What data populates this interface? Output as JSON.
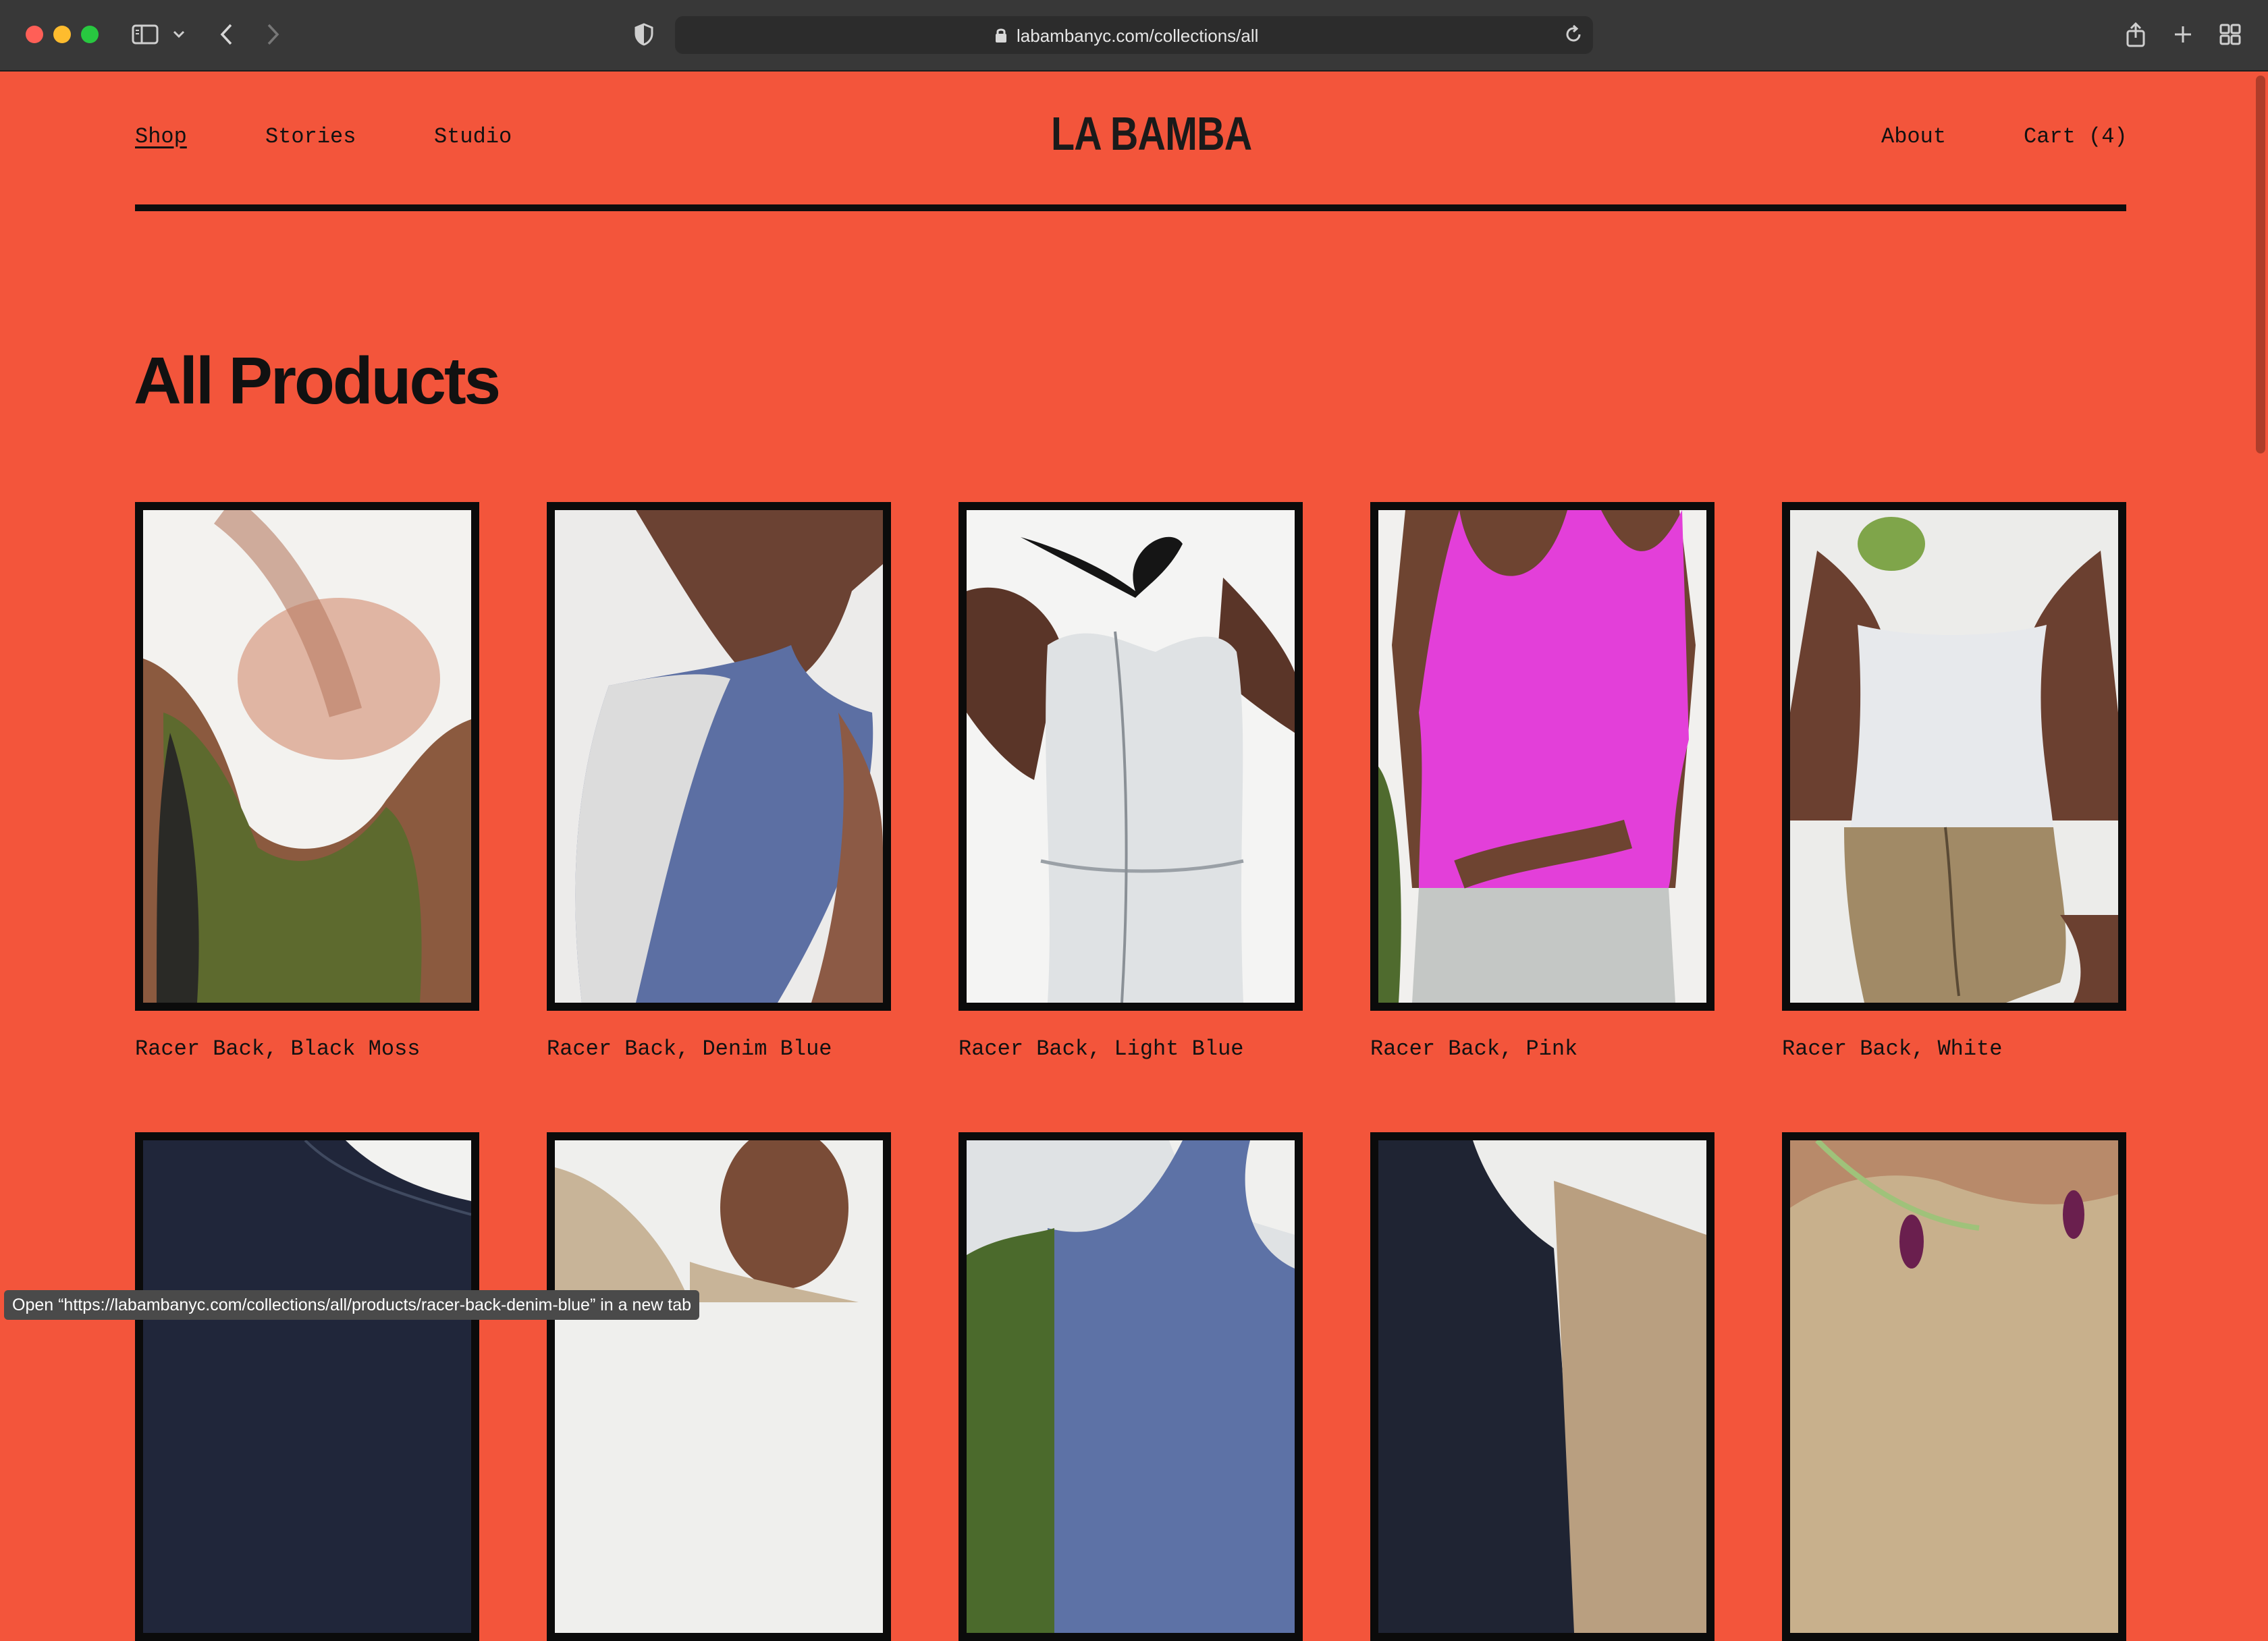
{
  "browser": {
    "url": "labambanyc.com/collections/all",
    "status_text": "Open “https://labambanyc.com/collections/all/products/racer-back-denim-blue” in a new tab",
    "colors": {
      "chrome": "#383838",
      "address_bar": "#2c2c2c"
    }
  },
  "nav": {
    "left": [
      "Shop",
      "Stories",
      "Studio"
    ],
    "logo": "LA BAMBA",
    "about": "About",
    "cart": "Cart (4)"
  },
  "page": {
    "title": "All Products",
    "background": "#f3553b"
  },
  "products": [
    {
      "name": "Racer Back, Black Moss",
      "color": "#5d6a2e"
    },
    {
      "name": "Racer Back, Denim Blue",
      "color": "#5c6fa3"
    },
    {
      "name": "Racer Back, Light Blue",
      "color": "#dfe2e4"
    },
    {
      "name": "Racer Back, Pink",
      "color": "#e33fd9"
    },
    {
      "name": "Racer Back, White",
      "color": "#e7e9ec"
    }
  ],
  "products_row2": [
    {
      "color": "#20263a"
    },
    {
      "color": "#c8b498"
    },
    {
      "color": "#5d72a6"
    },
    {
      "color": "#1f2433"
    },
    {
      "color": "#c8b08c"
    }
  ]
}
